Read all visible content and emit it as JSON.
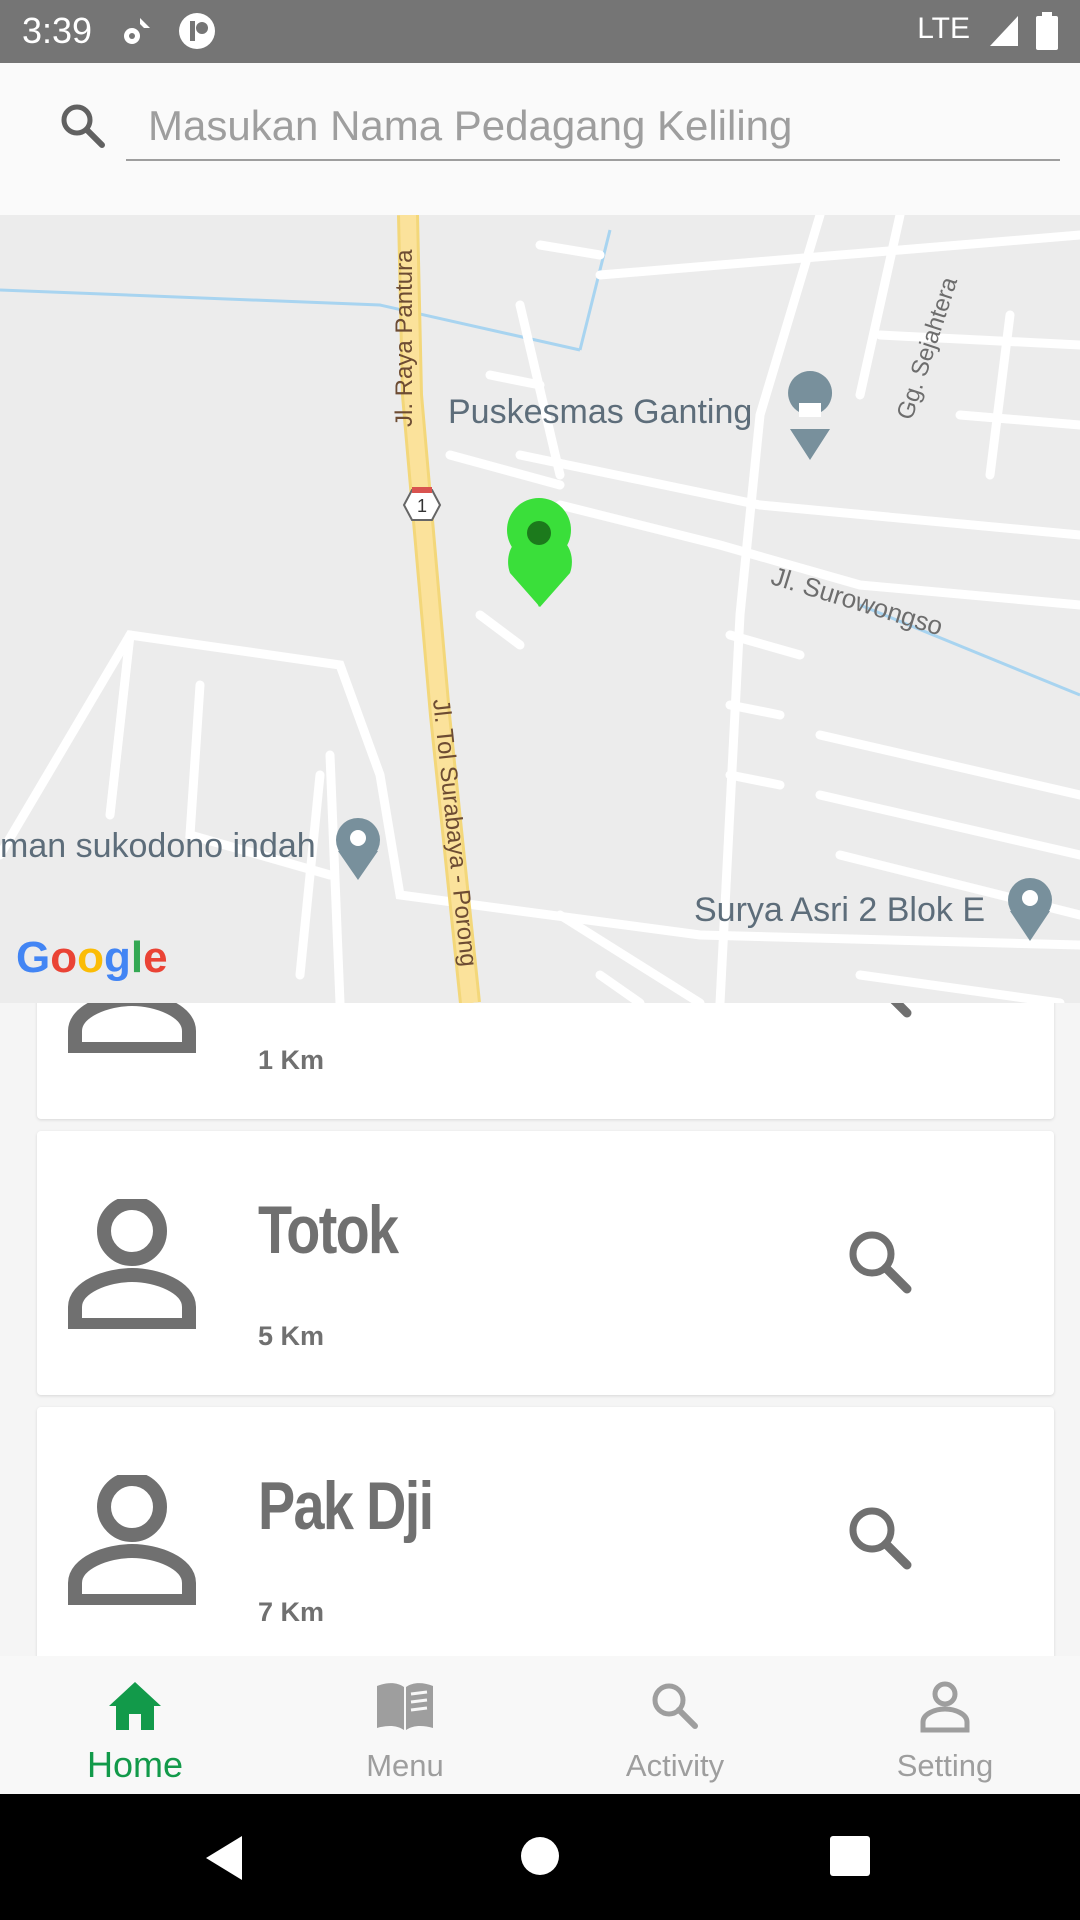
{
  "status_bar": {
    "time": "3:39",
    "network": "LTE"
  },
  "search": {
    "placeholder": "Masukan Nama Pedagang Keliling",
    "value": ""
  },
  "map": {
    "labels": {
      "puskesmas": "Puskesmas Ganting",
      "surowongso": "Jl. Surowongso",
      "sejahtera": "Gg. Sejahtera",
      "raya_pantura": "Jl. Raya Pantura",
      "tol": "Jl. Tol Surabaya - Porong",
      "sukodono": "man sukodono indah",
      "surya_asri": "Surya Asri 2 Blok E",
      "route_shield": "1"
    },
    "attribution": "Google"
  },
  "vendors": [
    {
      "name": "",
      "distance": "1 Km"
    },
    {
      "name": "Totok",
      "distance": "5 Km"
    },
    {
      "name": "Pak Dji",
      "distance": "7 Km"
    }
  ],
  "bottom_nav": [
    {
      "label": "Home",
      "icon": "home-icon",
      "active": true
    },
    {
      "label": "Menu",
      "icon": "book-icon",
      "active": false
    },
    {
      "label": "Activity",
      "icon": "search-icon",
      "active": false
    },
    {
      "label": "Setting",
      "icon": "person-icon",
      "active": false
    }
  ],
  "colors": {
    "accent": "#129a4a",
    "marker": "#3adf3a",
    "status_bar": "#757575"
  }
}
